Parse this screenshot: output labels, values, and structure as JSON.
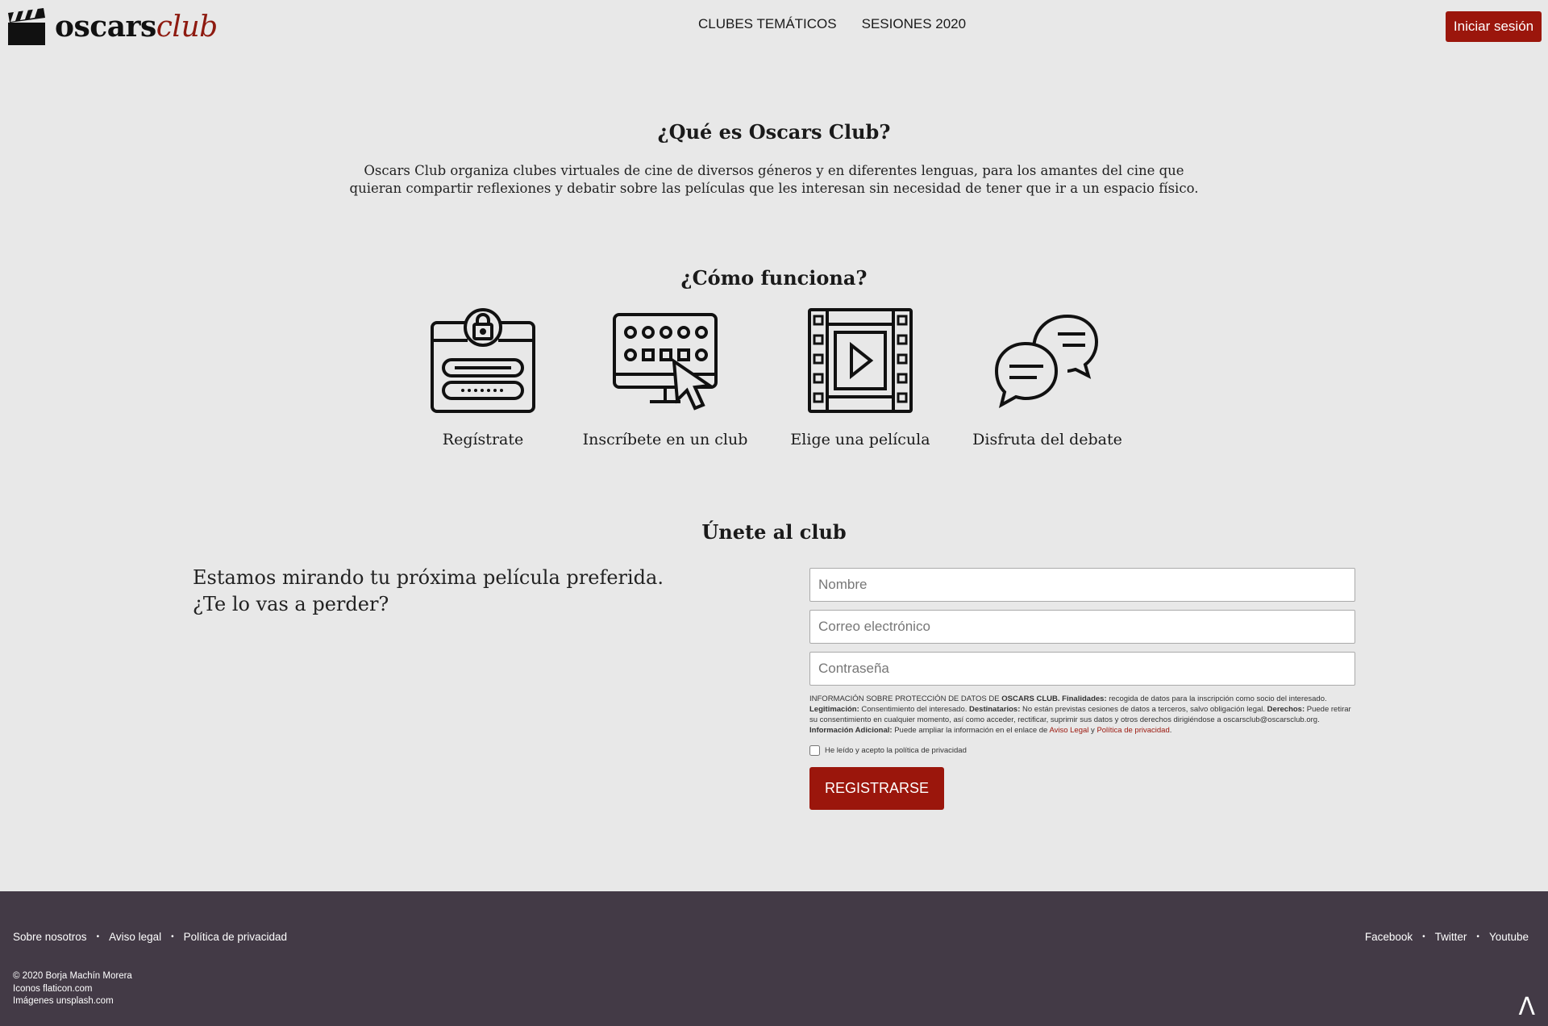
{
  "header": {
    "logo_bold": "oscars",
    "logo_italic": "club",
    "nav": [
      "CLUBES TEMÁTICOS",
      "SESIONES 2020"
    ],
    "login_label": "Iniciar sesión"
  },
  "about": {
    "title": "¿Qué es Oscars Club?",
    "text": "Oscars Club organiza clubes virtuales de cine de diversos géneros y en diferentes lenguas, para los amantes del cine que quieran compartir reflexiones y debatir sobre las películas que les interesan sin necesidad de tener que ir a un espacio físico."
  },
  "how": {
    "title": "¿Cómo funciona?",
    "steps": [
      {
        "label": "Regístrate",
        "icon": "register-lock-icon"
      },
      {
        "label": "Inscríbete en un club",
        "icon": "monitor-cursor-icon"
      },
      {
        "label": "Elige una película",
        "icon": "film-play-icon"
      },
      {
        "label": "Disfruta del debate",
        "icon": "chat-bubbles-icon"
      }
    ]
  },
  "join": {
    "title": "Únete al club",
    "lead_line1": "Estamos mirando tu próxima película preferida.",
    "lead_line2": "¿Te lo vas a perder?",
    "name_placeholder": "Nombre",
    "email_placeholder": "Correo electrónico",
    "password_placeholder": "Contraseña",
    "legal": {
      "p1": "INFORMACIÓN SOBRE PROTECCIÓN DE DATOS DE ",
      "b1": "OSCARS CLUB. Finalidades:",
      "p2": " recogida de datos para la inscripción como socio del interesado. ",
      "b2": "Legitimación:",
      "p3": " Consentimiento del interesado. ",
      "b3": "Destinatarios:",
      "p4": " No están previstas cesiones de datos a terceros, salvo obligación legal. ",
      "b4": "Derechos:",
      "p5": " Puede retirar su consentimiento en cualquier momento, así como acceder, rectificar, suprimir sus datos y otros derechos dirigiéndose a oscarsclub@oscarsclub.org. ",
      "b5": "Información Adicional:",
      "p6": " Puede ampliar la información en el enlace de ",
      "link1": "Aviso Legal",
      "p7": " y ",
      "link2": "Política de privacidad",
      "p8": "."
    },
    "checkbox_label": "He leído y acepto la política de privacidad",
    "submit_label": "REGISTRARSE"
  },
  "footer": {
    "left_links": [
      "Sobre nosotros",
      "Aviso legal",
      "Política de privacidad"
    ],
    "right_links": [
      "Facebook",
      "Twitter",
      "Youtube"
    ],
    "credits": [
      "© 2020 Borja Machín Morera",
      "Iconos flaticon.com",
      "Imágenes unsplash.com"
    ],
    "top_icon": "Λ"
  },
  "colors": {
    "accent": "#9b160c",
    "background": "#e8e8e8",
    "footer": "#433a46"
  }
}
